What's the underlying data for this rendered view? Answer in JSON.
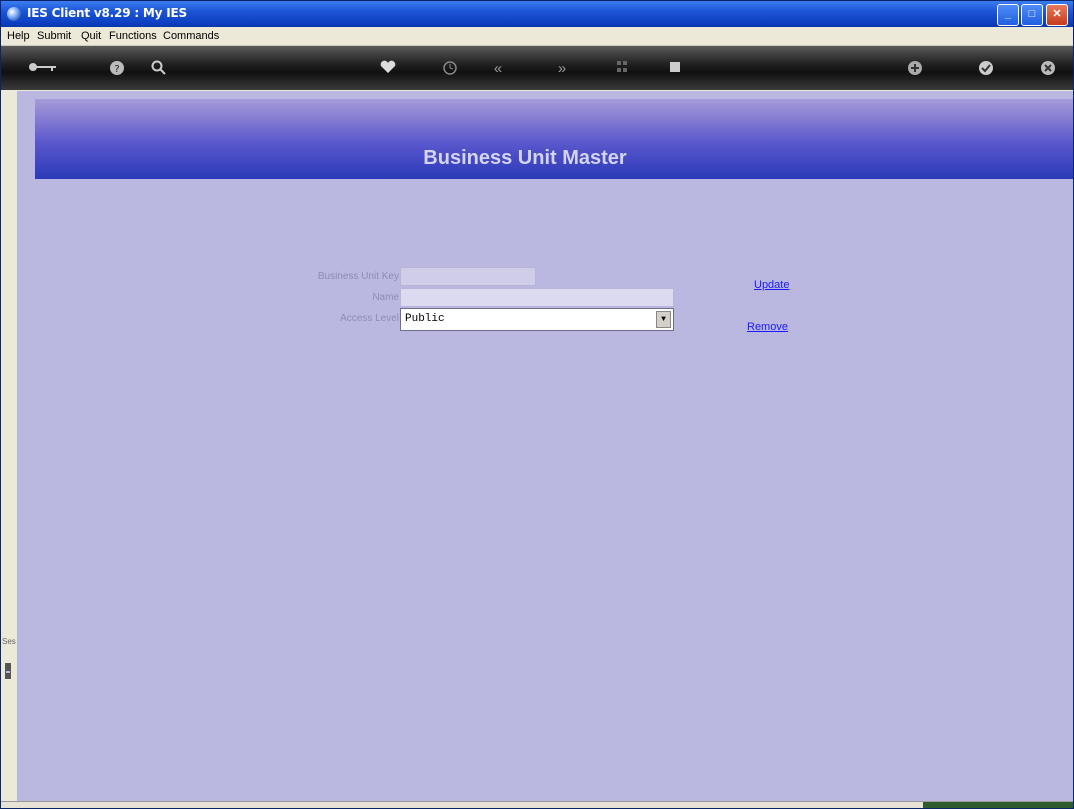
{
  "window": {
    "title": "IES Client v8.29 : My IES",
    "controls": {
      "minimize": "_",
      "maximize": "□",
      "close": "✕"
    }
  },
  "menu": [
    "Help",
    "Submit",
    "Quit",
    "Functions",
    "Commands"
  ],
  "toolbar": {
    "icons": [
      "key-icon",
      "help-icon",
      "search-icon",
      "heart-icon",
      "clock-icon",
      "rewind-icon",
      "fast-forward-icon",
      "grid-icon",
      "stop-icon",
      "add-icon",
      "check-icon",
      "close-icon"
    ]
  },
  "page": {
    "title": "Business Unit Master"
  },
  "form": {
    "key_label": "Business Unit Key",
    "key_value": "",
    "name_label": "Name",
    "name_value": "",
    "access_label": "Access Level",
    "access_value": "Public"
  },
  "actions": {
    "update": "Update",
    "remove": "Remove"
  },
  "side": {
    "label": "Ses"
  },
  "colors": {
    "content_bg": "#bab8e0",
    "banner_dark": "#2a3ab8",
    "link": "#1a1aff"
  }
}
